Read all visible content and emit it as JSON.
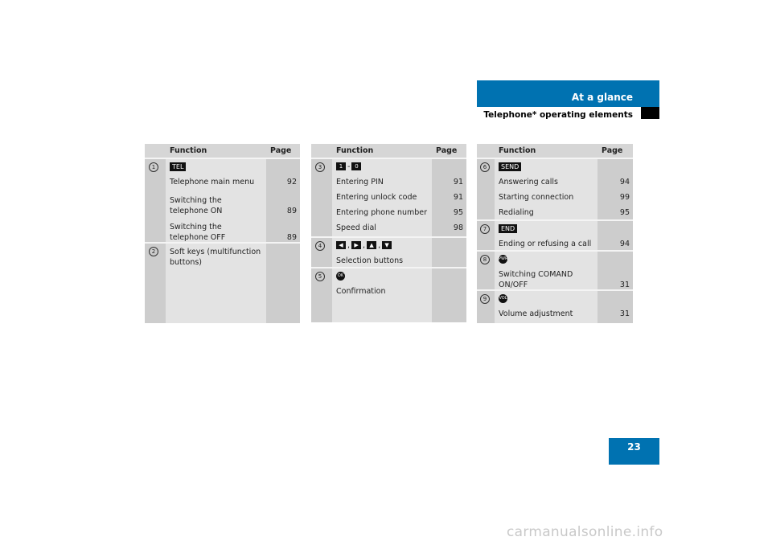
{
  "header": {
    "section": "At a glance",
    "subtitle": "Telephone* operating elements"
  },
  "page_number": "23",
  "watermark": "carmanualsonline.info",
  "table_headers": {
    "function": "Function",
    "page": "Page"
  },
  "tables": [
    {
      "rows": [
        {
          "num": "1",
          "key": "TEL",
          "items": [
            {
              "text": "Telephone main menu",
              "page": "92"
            },
            {
              "text": "Switching the telephone ON",
              "page": "89"
            },
            {
              "text": "Switching the telephone OFF",
              "page": "89"
            }
          ]
        },
        {
          "num": "2",
          "items": [
            {
              "text": "Soft keys (multifunction buttons)",
              "page": ""
            }
          ]
        }
      ]
    },
    {
      "rows": [
        {
          "num": "3",
          "key_from": "1",
          "key_to": "0",
          "key_sep": "-",
          "items": [
            {
              "text": "Entering PIN",
              "page": "91"
            },
            {
              "text": "Entering unlock code",
              "page": "91"
            },
            {
              "text": "Entering phone number",
              "page": "95"
            },
            {
              "text": "Speed dial",
              "page": "98"
            }
          ]
        },
        {
          "num": "4",
          "keys": [
            "◀",
            "▶",
            "▲",
            "▼"
          ],
          "items": [
            {
              "text": "Selection buttons",
              "page": ""
            }
          ]
        },
        {
          "num": "5",
          "key": "OK",
          "items": [
            {
              "text": "Confirmation",
              "page": ""
            }
          ]
        }
      ]
    },
    {
      "rows": [
        {
          "num": "6",
          "key": "SEND",
          "items": [
            {
              "text": "Answering calls",
              "page": "94"
            },
            {
              "text": "Starting connection",
              "page": "99"
            },
            {
              "text": "Redialing",
              "page": "95"
            }
          ]
        },
        {
          "num": "7",
          "key": "END",
          "items": [
            {
              "text": "Ending or refusing a call",
              "page": "94"
            }
          ]
        },
        {
          "num": "8",
          "key": "PWR",
          "items": [
            {
              "text": "Switching COMAND ON/OFF",
              "page": "31"
            }
          ]
        },
        {
          "num": "9",
          "key": "VOL",
          "items": [
            {
              "text": "Volume adjustment",
              "page": "31"
            }
          ]
        }
      ]
    }
  ],
  "colors": {
    "accent": "#0072b1"
  }
}
